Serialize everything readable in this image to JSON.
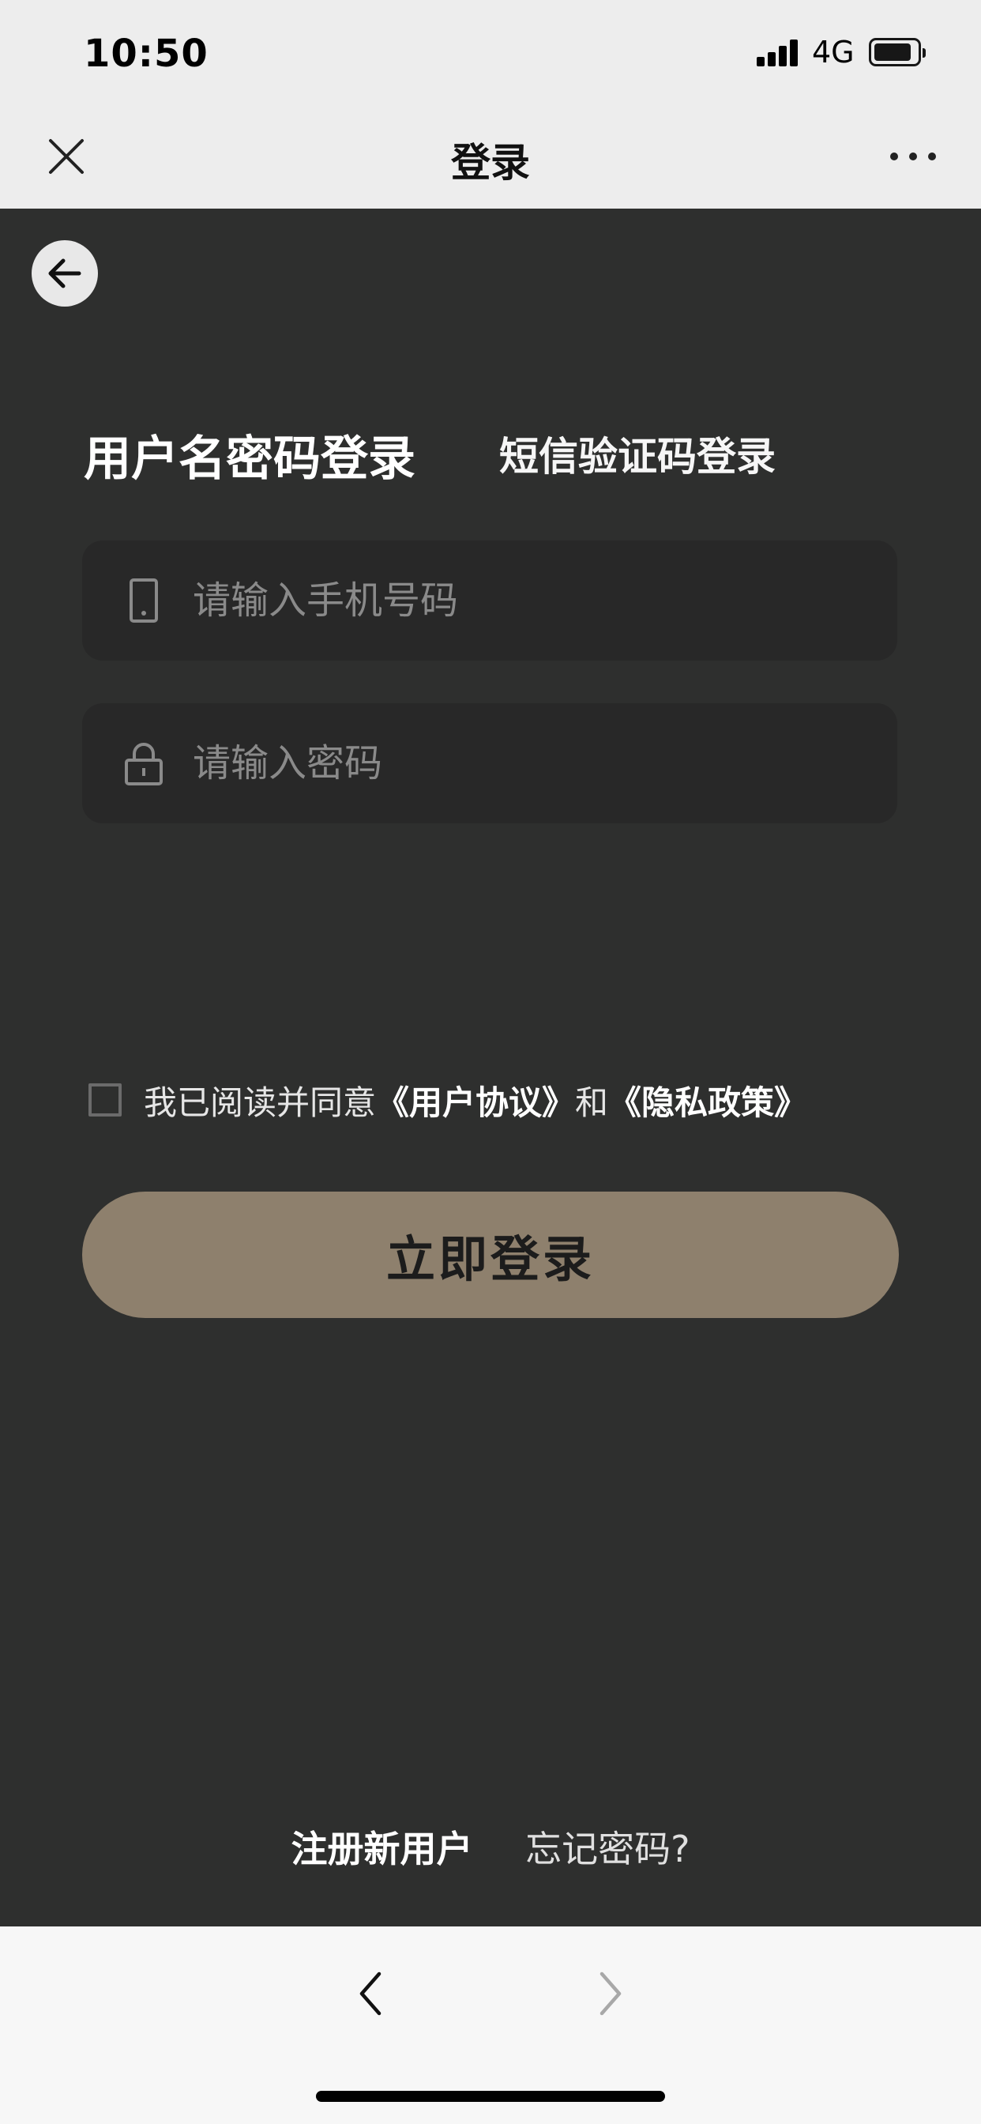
{
  "status": {
    "time": "10:50",
    "network": "4G"
  },
  "nav": {
    "title": "登录",
    "close_icon": "close-icon",
    "more_icon": "more-icon"
  },
  "login": {
    "tabs": [
      "用户名密码登录",
      "短信验证码登录"
    ],
    "phone_placeholder": "请输入手机号码",
    "password_placeholder": "请输入密码",
    "agreement": {
      "prefix": "我已阅读并同意",
      "user_agreement": "《用户协议》",
      "conjunction": "和",
      "privacy_policy": "《隐私政策》"
    },
    "submit_label": "立即登录"
  },
  "footer": {
    "register": "注册新用户",
    "forgot": "忘记密码?"
  },
  "colors": {
    "background": "#2e2f2e",
    "field_bg": "#282828",
    "accent_button": "#8e806d",
    "bar_bg": "#ededed"
  }
}
